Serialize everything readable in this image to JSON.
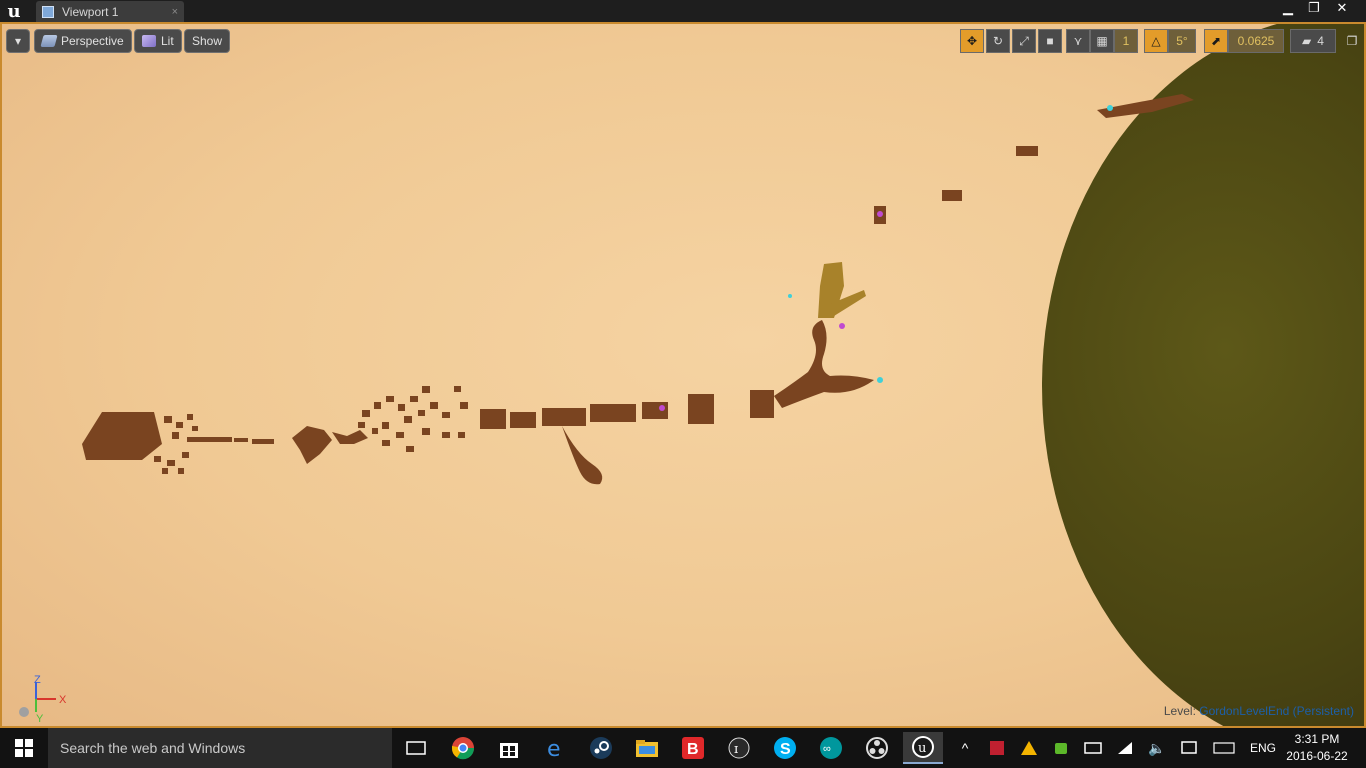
{
  "window": {
    "tab_label": "Viewport 1",
    "tab_close": "×",
    "controls": {
      "minimize": "▁",
      "maximize": "❐",
      "close": "✕"
    }
  },
  "viewport": {
    "buttons": {
      "dropdown": "▾",
      "perspective": "Perspective",
      "lit": "Lit",
      "show": "Show"
    },
    "toolbar": {
      "grid_snap_value": "1",
      "rotation_snap_value": "5°",
      "scale_snap_value": "0.0625",
      "camera_speed_value": "4"
    },
    "axis": {
      "z": "Z",
      "x": "X",
      "y": "Y"
    },
    "level": {
      "label": "Level:",
      "name": "GordonLevelEnd (Persistent)"
    },
    "colors": {
      "sky": "#f0c994",
      "rock": "#7a4420",
      "planet": "#4e4a14",
      "accent": "#e39c2a"
    }
  },
  "taskbar": {
    "search_placeholder": "Search the web and Windows",
    "apps": [
      "task-view",
      "chrome",
      "store",
      "edge",
      "steam",
      "file-explorer",
      "b-app",
      "inkscape",
      "skype",
      "arduino",
      "obs",
      "unreal-engine"
    ],
    "language": "ENG",
    "clock": {
      "time": "3:31 PM",
      "date": "2016-06-22"
    }
  }
}
